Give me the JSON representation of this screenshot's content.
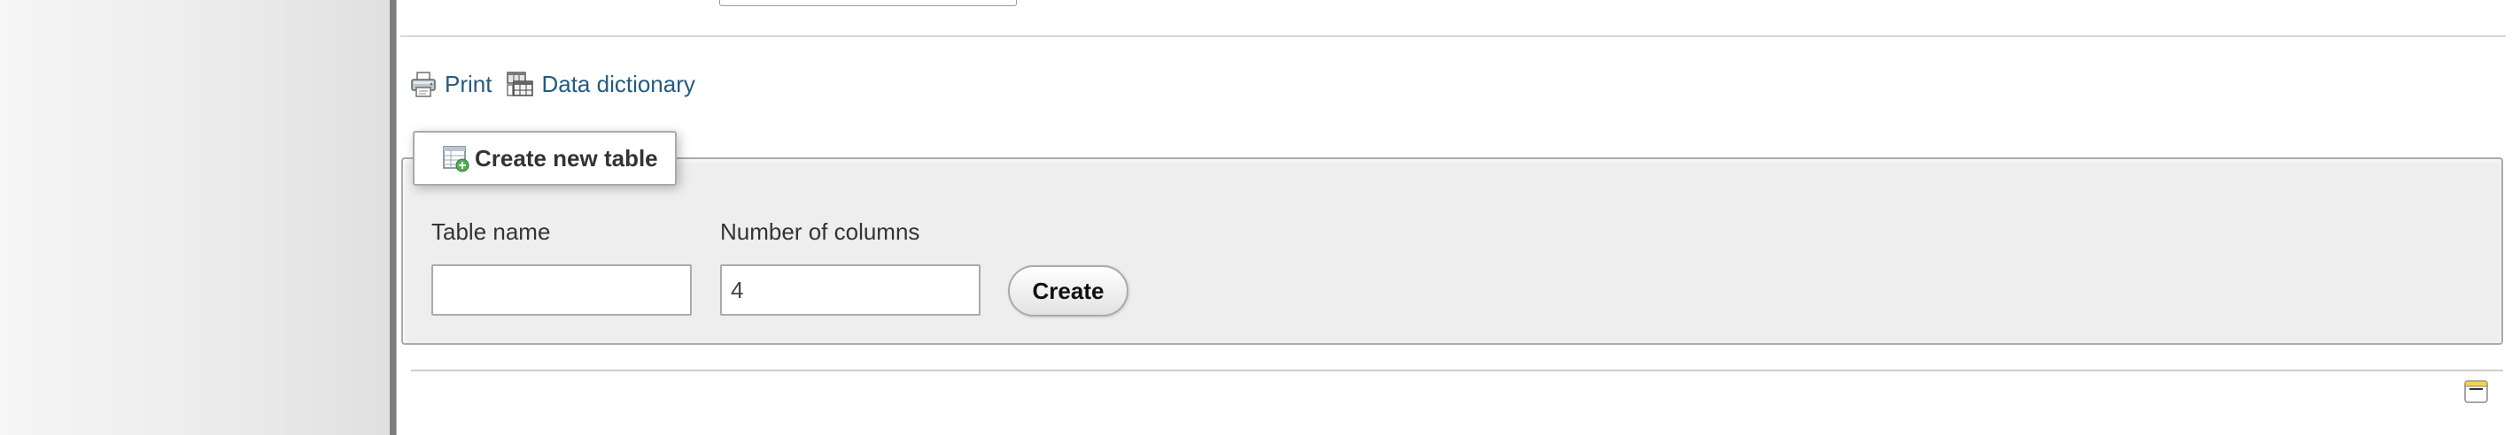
{
  "links": {
    "print_label": "Print",
    "data_dictionary_label": "Data dictionary"
  },
  "create_table": {
    "legend": "Create new table",
    "table_name_label": "Table name",
    "table_name_value": "",
    "num_columns_label": "Number of columns",
    "num_columns_value": "4",
    "create_button_label": "Create"
  },
  "icons": {
    "print": "printer-icon",
    "data_dictionary": "data-dictionary-icon",
    "create_table": "table-add-icon",
    "console": "console-window-icon"
  },
  "colors": {
    "link": "#235a81",
    "fieldset_bg": "#eeeeee",
    "nav_divider": "#7d7d7d"
  }
}
